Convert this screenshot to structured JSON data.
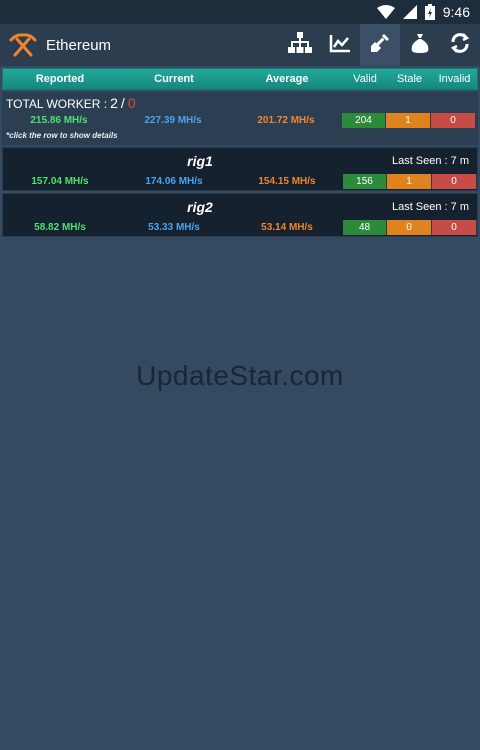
{
  "status": {
    "time": "9:46"
  },
  "app": {
    "title": "Ethereum"
  },
  "toolbar": [
    "network-icon",
    "chart-icon",
    "pickaxe-icon",
    "money-bag-icon",
    "refresh-icon"
  ],
  "columns": {
    "reported": "Reported",
    "current": "Current",
    "average": "Average",
    "valid": "Valid",
    "stale": "Stale",
    "invalid": "Invalid"
  },
  "total": {
    "label": "TOTAL WORKER :",
    "active": "2",
    "separator": "/",
    "offline": "0",
    "reported": "215.86 MH/s",
    "current": "227.39 MH/s",
    "average": "201.72 MH/s",
    "valid": "204",
    "stale": "1",
    "invalid": "0"
  },
  "hint": "*click the row to show details",
  "rigs": [
    {
      "name": "rig1",
      "last_seen": "Last Seen : 7 m",
      "reported": "157.04 MH/s",
      "current": "174.06 MH/s",
      "average": "154.15 MH/s",
      "valid": "156",
      "stale": "1",
      "invalid": "0"
    },
    {
      "name": "rig2",
      "last_seen": "Last Seen : 7 m",
      "reported": "58.82 MH/s",
      "current": "53.33 MH/s",
      "average": "53.14 MH/s",
      "valid": "48",
      "stale": "0",
      "invalid": "0"
    }
  ],
  "watermark": "UpdateStar.com",
  "colors": {
    "background": "#344a60",
    "header": "#1a9a8e",
    "reported": "#4fe06e",
    "current": "#4aa3f0",
    "average": "#f0862c",
    "valid": "#2c8a3a",
    "stale": "#e0821e",
    "invalid": "#c84c46"
  }
}
